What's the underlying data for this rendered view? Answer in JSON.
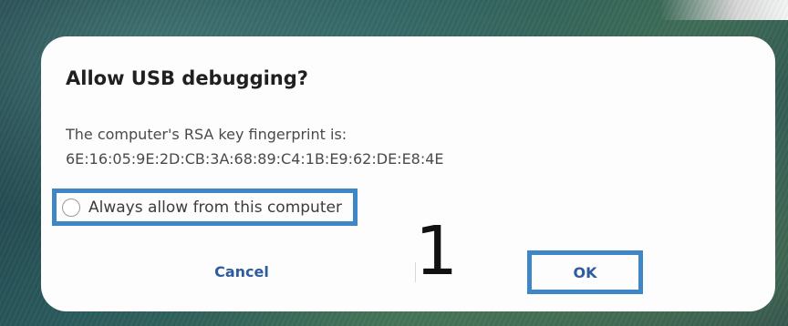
{
  "dialog": {
    "title": "Allow USB debugging?",
    "message_line1": "The computer's RSA key fingerprint is:",
    "fingerprint": "6E:16:05:9E:2D:CB:3A:68:89:C4:1B:E9:62:DE:E8:4E",
    "checkbox_label": "Always allow from this computer",
    "checkbox_checked": false,
    "cancel_label": "Cancel",
    "ok_label": "OK"
  },
  "annotation": {
    "step_number": "1",
    "highlight_color": "#3f86c6"
  },
  "colors": {
    "button_text": "#2f5c9c",
    "dialog_background": "#fdfdfd"
  }
}
